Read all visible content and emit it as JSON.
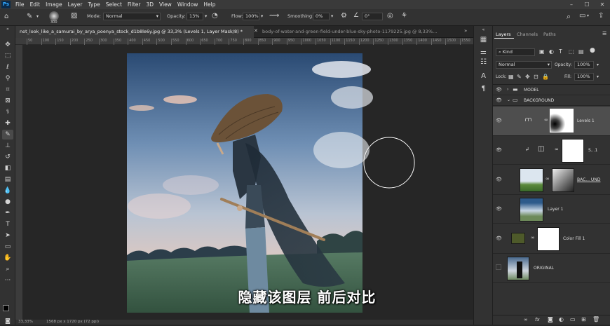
{
  "menubar": {
    "items": [
      "File",
      "Edit",
      "Image",
      "Layer",
      "Type",
      "Select",
      "Filter",
      "3D",
      "View",
      "Window",
      "Help"
    ],
    "app_icon": "Ps",
    "window_controls": [
      "–",
      "☐",
      "✕"
    ]
  },
  "options": {
    "brush_size": "300",
    "mode_label": "Mode:",
    "mode_value": "Normal",
    "opacity_label": "Opacity:",
    "opacity_value": "13%",
    "flow_label": "Flow:",
    "flow_value": "100%",
    "smoothing_label": "Smoothing:",
    "smoothing_value": "0%",
    "angle_value": "0°"
  },
  "tabs": [
    {
      "label": "not_look_like_a_samurai_by_arya_poenya_stock_d1b8le6y.jpg @ 33,3% (Levels 1, Layer Mask/8) *",
      "active": true
    },
    {
      "label": "body-of-water-and-green-field-under-blue-sky-photo-1179225.jpg @ 8,33%...",
      "active": false
    }
  ],
  "ruler_marks": [
    "50",
    "100",
    "150",
    "200",
    "250",
    "300",
    "350",
    "400",
    "450",
    "500",
    "550",
    "600",
    "650",
    "700",
    "750",
    "800",
    "850",
    "900",
    "950",
    "1000",
    "1050",
    "1100",
    "1150",
    "1200",
    "1250",
    "1300",
    "1350",
    "1400",
    "1450",
    "1500",
    "1550"
  ],
  "status": {
    "zoom": "33,33%",
    "size": "1568 px x 1720 px (72 ppi)"
  },
  "subtitle": "隐藏该图层 前后对比",
  "panel": {
    "tabs": [
      "Layers",
      "Channels",
      "Paths"
    ],
    "filter_kind": "Kind",
    "blend_mode": "Normal",
    "opacity_label": "Opacity:",
    "opacity_value": "100%",
    "lock_label": "Lock:",
    "fill_label": "Fill:",
    "fill_value": "100%",
    "layers": [
      {
        "name": "MODEL",
        "type": "group"
      },
      {
        "name": "BACKGROUND",
        "type": "group"
      },
      {
        "name": "Levels 1",
        "type": "adjustment"
      },
      {
        "name": "S...1",
        "type": "clipped"
      },
      {
        "name": "BAC... UND",
        "type": "masked"
      },
      {
        "name": "Layer 1",
        "type": "pixel"
      },
      {
        "name": "Color Fill 1",
        "type": "fill"
      },
      {
        "name": "ORIGINAL",
        "type": "pixel"
      }
    ],
    "footer_icons": [
      "link-icon",
      "fx-icon",
      "mask-icon",
      "adjustment-icon",
      "folder-icon",
      "new-layer-icon",
      "trash-icon"
    ]
  },
  "colors": {
    "accent": "#31a8ff",
    "fill_layer": "#4e5a2a"
  }
}
